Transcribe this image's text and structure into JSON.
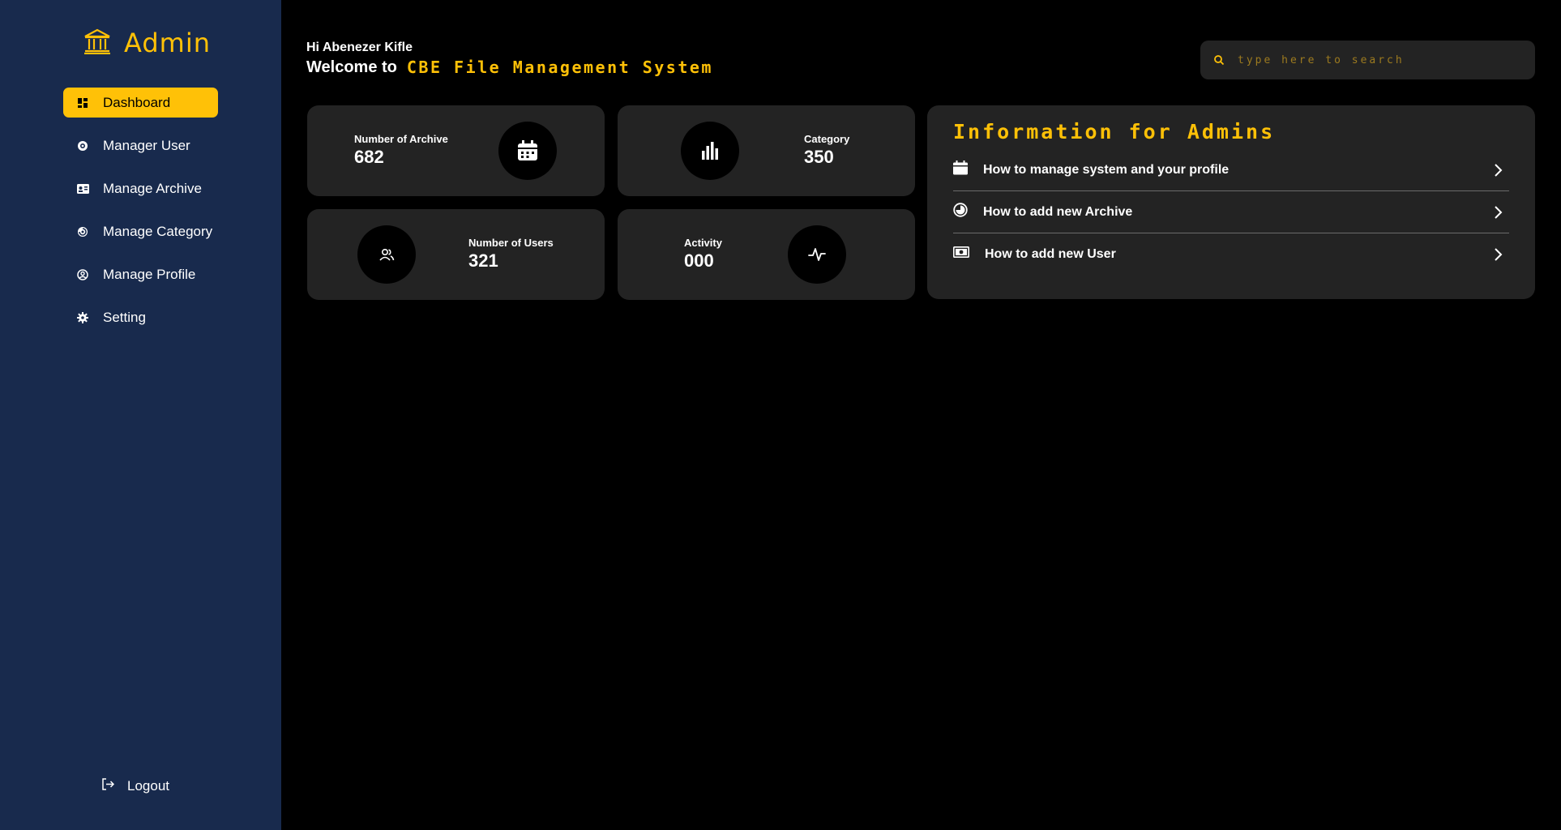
{
  "sidebar": {
    "brand": "Admin",
    "items": [
      {
        "label": "Dashboard",
        "icon": "dashboard-icon",
        "active": true
      },
      {
        "label": "Manager User",
        "icon": "user-gear-icon"
      },
      {
        "label": "Manage Archive",
        "icon": "id-card-icon"
      },
      {
        "label": "Manage Category",
        "icon": "category-icon"
      },
      {
        "label": "Manage Profile",
        "icon": "profile-icon"
      },
      {
        "label": "Setting",
        "icon": "gear-icon"
      }
    ],
    "logout": "Logout"
  },
  "header": {
    "greeting": "Hi Abenezer Kifle",
    "welcome": "Welcome to",
    "system_name": "CBE File Management System"
  },
  "search": {
    "placeholder": "type here to search"
  },
  "stats": {
    "archive": {
      "label": "Number of Archive",
      "value": "682"
    },
    "category": {
      "label": "Category",
      "value": "350"
    },
    "users": {
      "label": "Number of Users",
      "value": "321"
    },
    "activity": {
      "label": "Activity",
      "value": "000"
    }
  },
  "info": {
    "title": "Information for Admins",
    "items": [
      {
        "label": "How to manage system and your profile",
        "icon": "calendar-icon"
      },
      {
        "label": "How to add new Archive",
        "icon": "pie-chart-icon"
      },
      {
        "label": "How to add new User",
        "icon": "money-bill-icon"
      }
    ]
  },
  "colors": {
    "sidebar_bg": "#182a4d",
    "accent": "#ffc107",
    "card_bg": "#232323",
    "page_bg": "#000000"
  }
}
